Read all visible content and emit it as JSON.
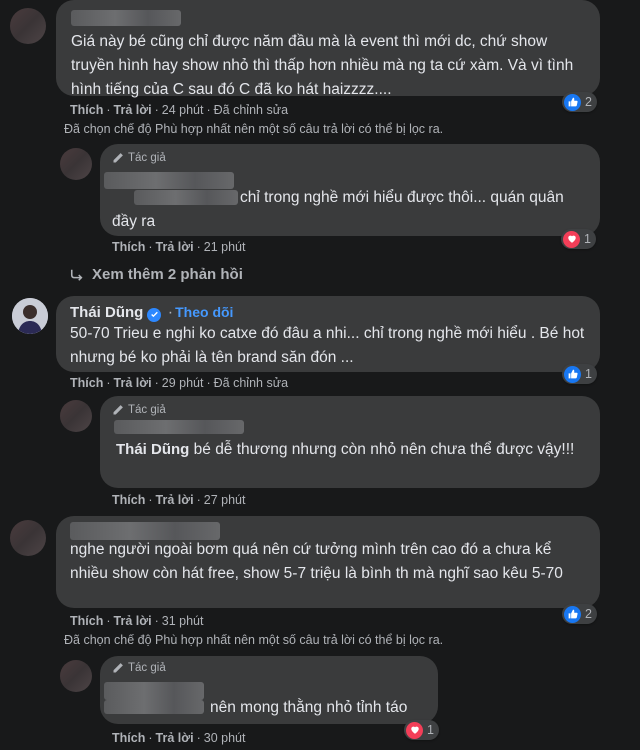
{
  "comments": [
    {
      "name": "",
      "text": "Giá này bé cũng chỉ được năm đầu mà là event thì mới dc, chứ show truyền hình hay show nhỏ thì thấp hơn nhiều mà ng ta cứ xàm. Và vì tình hình tiếng của C sau đó C đã ko hát haizzzz....",
      "like": "Thích",
      "reply": "Trả lời",
      "time": "24 phút",
      "edited": "Đã chỉnh sửa",
      "reactions": "2",
      "filter_note": "Đã chọn chế độ Phù hợp nhất nên một số câu trả lời có thể bị lọc ra.",
      "reply_item": {
        "author_tag": "Tác giả",
        "text": "chỉ trong nghề mới hiểu được thôi... quán quân đầy ra",
        "like": "Thích",
        "reply": "Trả lời",
        "time": "21 phút",
        "reactions": "1"
      },
      "view_more": "Xem thêm 2 phản hồi"
    },
    {
      "name": "Thái Dũng",
      "follow": "Theo dõi",
      "text": "50-70 Trieu e nghi ko catxe đó đâu a nhi... chỉ trong nghề mới hiểu . Bé hot nhưng bé ko phải là tên brand săn đón ...",
      "like": "Thích",
      "reply": "Trả lời",
      "time": "29 phút",
      "edited": "Đã chỉnh sửa",
      "reactions": "1",
      "reply_item": {
        "author_tag": "Tác giả",
        "mention": "Thái Dũng",
        "text": "bé dễ thương nhưng còn nhỏ nên chưa thể được vậy!!!",
        "like": "Thích",
        "reply": "Trả lời",
        "time": "27 phút"
      }
    },
    {
      "text": "nghe người ngoài bơm quá nên cứ tưởng mình trên cao đó a chưa kể nhiều show còn hát free, show 5-7 triệu là bình th mà nghĩ sao kêu 5-70",
      "like": "Thích",
      "reply": "Trả lời",
      "time": "31 phút",
      "reactions": "2",
      "filter_note": "Đã chọn chế độ Phù hợp nhất nên một số câu trả lời có thể bị lọc ra.",
      "reply_item": {
        "author_tag": "Tác giả",
        "text": "nên mong thằng nhỏ tỉnh táo",
        "like": "Thích",
        "reply": "Trả lời",
        "time": "30 phút",
        "reactions": "1"
      }
    }
  ],
  "colors": {
    "like": "#1877f2",
    "love": "#f33e58",
    "link": "#4599ff",
    "bubble": "#3a3b3c",
    "bg": "#18191a"
  },
  "icons": {
    "like": "thumbs-up-icon",
    "love": "heart-icon",
    "author": "pen-icon",
    "reply_arrow": "reply-arrow-icon",
    "verified": "verified-badge-icon"
  }
}
